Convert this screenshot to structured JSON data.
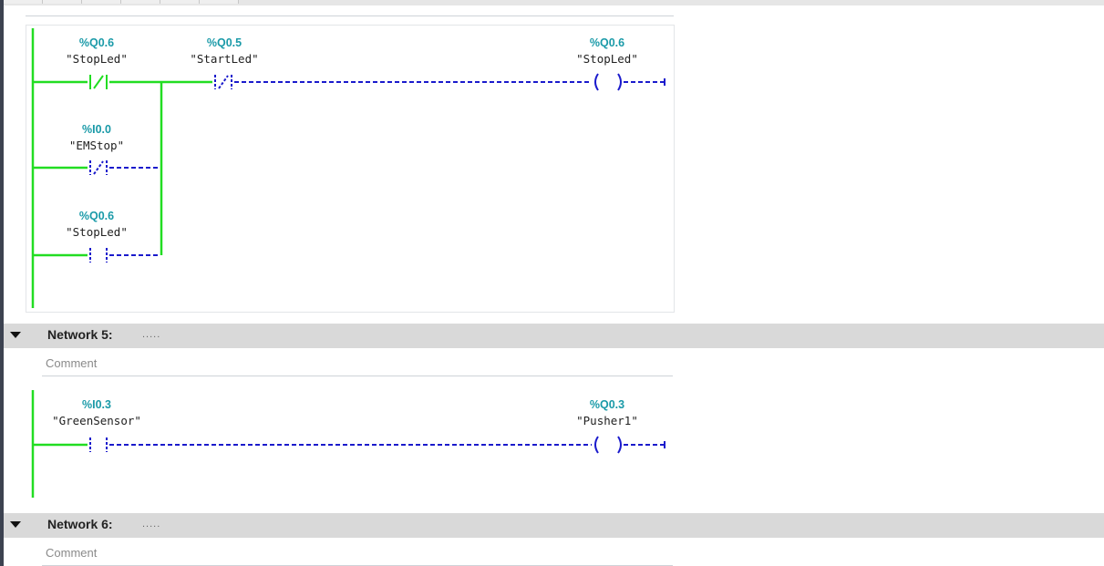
{
  "network4": {
    "contacts": [
      {
        "address": "%Q0.6",
        "tag": "\"StopLed\"",
        "type": "NC",
        "powered": true
      },
      {
        "address": "%Q0.5",
        "tag": "\"StartLed\"",
        "type": "NC",
        "powered": false
      },
      {
        "address": "%I0.0",
        "tag": "\"EMStop\"",
        "type": "NC",
        "powered": false
      },
      {
        "address": "%Q0.6",
        "tag": "\"StopLed\"",
        "type": "NO",
        "powered": false
      }
    ],
    "coil": {
      "address": "%Q0.6",
      "tag": "\"StopLed\"",
      "powered": false
    }
  },
  "network5": {
    "title": "Network 5:",
    "dots": ".....",
    "comment_placeholder": "Comment",
    "contacts": [
      {
        "address": "%I0.3",
        "tag": "\"GreenSensor\"",
        "type": "NO",
        "powered": false
      }
    ],
    "coil": {
      "address": "%Q0.3",
      "tag": "\"Pusher1\"",
      "powered": false
    }
  },
  "network6": {
    "title": "Network 6:",
    "dots": ".....",
    "comment_placeholder": "Comment"
  },
  "colors": {
    "power_flow": "#22dd22",
    "no_power": "#1a1acc",
    "address": "#1a9aa8",
    "header_bg": "#d9d9d9"
  }
}
